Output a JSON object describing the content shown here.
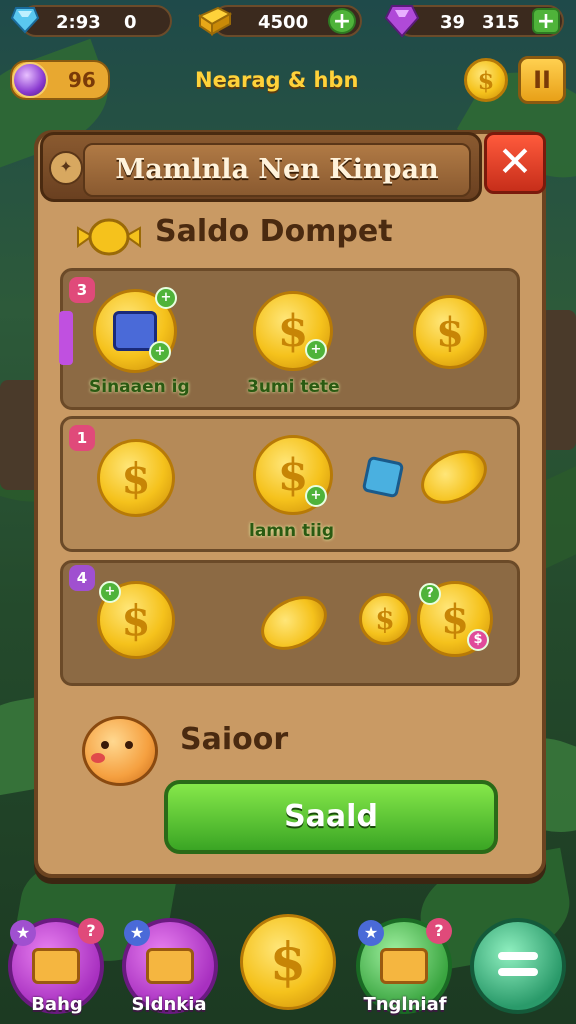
{
  "topbar": {
    "timer": "2:93",
    "gems": "0",
    "gold": "4500",
    "stars_a": "39",
    "stars_b": "315",
    "plus_symbol": "+"
  },
  "row2": {
    "orb_count": "96",
    "title": "Nearag & hbn",
    "pause_symbol": "II"
  },
  "panel": {
    "title": "Mamlnla Nen Kinpan",
    "close_symbol": "✕",
    "subheading": "Saldo Dompet",
    "rows": [
      {
        "number": "3",
        "labels": [
          "Sinaaen ig",
          "3umi tete"
        ]
      },
      {
        "number": "1",
        "labels": [
          "lamn tiig"
        ]
      },
      {
        "number": "4",
        "labels": []
      }
    ],
    "footer_label": "Saioor",
    "action_button": "Saald",
    "coin_symbol": "$"
  },
  "nav": {
    "items": [
      {
        "label": "Bahg",
        "badge": "?"
      },
      {
        "label": "Sldnkia",
        "badge": ""
      },
      {
        "label": "",
        "badge": ""
      },
      {
        "label": "Tnglniaf",
        "badge": "?"
      },
      {
        "label": "",
        "badge": ""
      }
    ]
  },
  "colors": {
    "accent_green": "#4fb33a",
    "panel": "#c99a64",
    "close_red": "#d83a22",
    "gold": "#f5c21c"
  }
}
